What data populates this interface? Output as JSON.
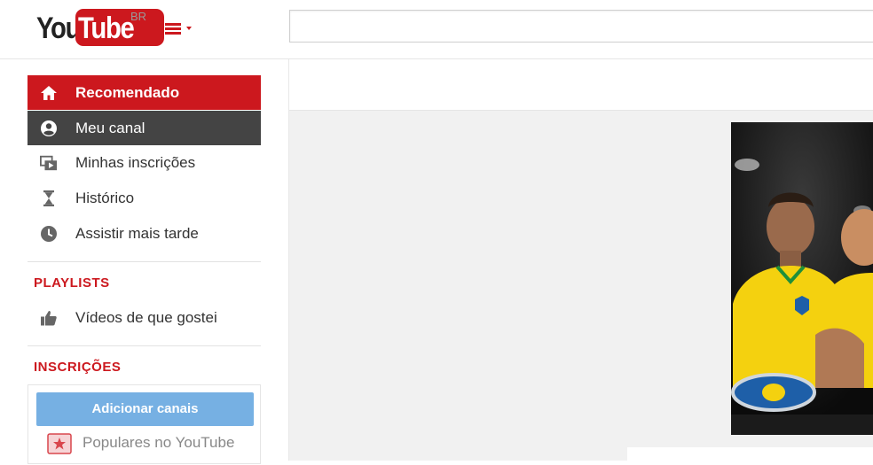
{
  "header": {
    "logo_left": "You",
    "logo_right": "Tube",
    "region": "BR",
    "search_placeholder": ""
  },
  "sidebar": {
    "items": [
      {
        "label": "Recomendado",
        "icon": "home-icon",
        "state": "selected"
      },
      {
        "label": "Meu canal",
        "icon": "account-icon",
        "state": "hover"
      },
      {
        "label": "Minhas inscrições",
        "icon": "subscriptions-icon",
        "state": "normal"
      },
      {
        "label": "Histórico",
        "icon": "hourglass-icon",
        "state": "normal"
      },
      {
        "label": "Assistir mais tarde",
        "icon": "clock-icon",
        "state": "normal"
      }
    ],
    "playlists": {
      "title": "PLAYLISTS",
      "items": [
        {
          "label": "Vídeos de que gostei",
          "icon": "thumbs-up-icon"
        }
      ]
    },
    "subscriptions": {
      "title": "INSCRIÇÕES",
      "add_button": "Adicionar canais",
      "items": [
        {
          "label": "Populares no YouTube",
          "icon": "popular-star-icon"
        }
      ]
    }
  },
  "colors": {
    "accent": "#cc181e",
    "hover": "#444444",
    "button_blue": "#76b0e3",
    "main_bg": "#f1f1f1"
  }
}
